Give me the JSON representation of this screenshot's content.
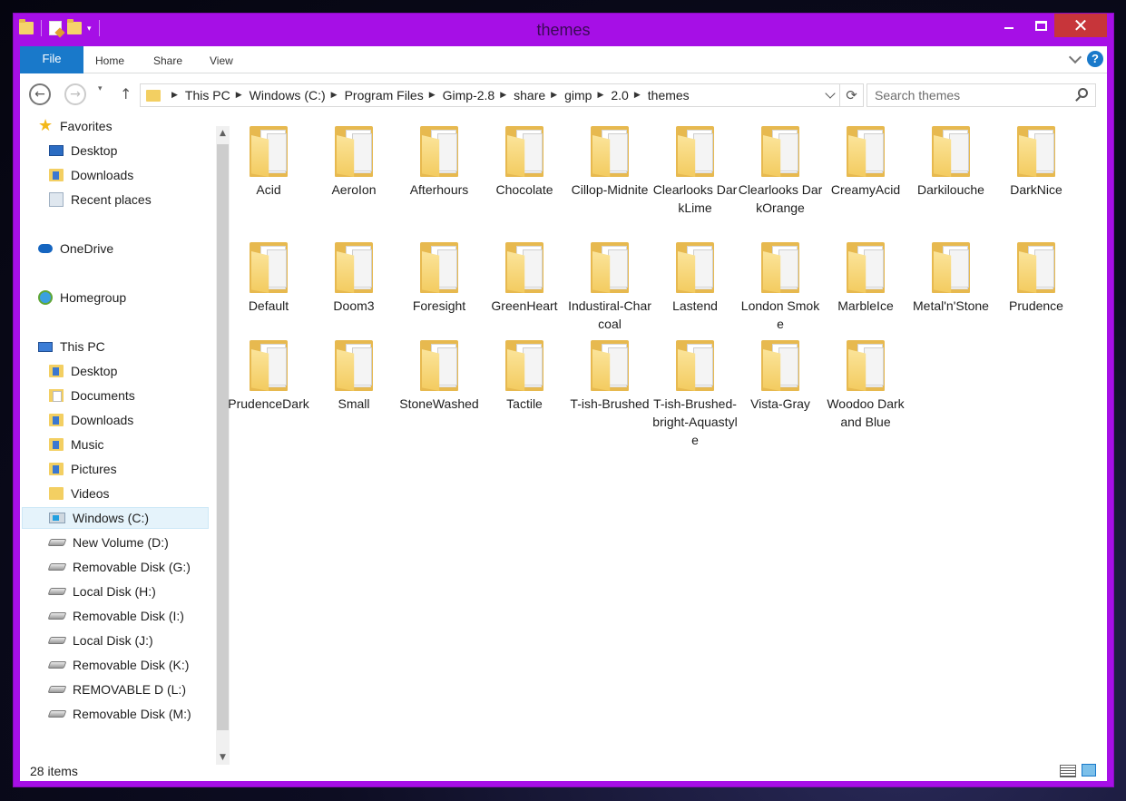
{
  "window": {
    "title": "themes"
  },
  "ribbon": {
    "tabs": [
      "File",
      "Home",
      "Share",
      "View"
    ]
  },
  "address": {
    "crumbs": [
      "This PC",
      "Windows (C:)",
      "Program Files",
      "Gimp-2.8",
      "share",
      "gimp",
      "2.0",
      "themes"
    ]
  },
  "search": {
    "placeholder": "Search themes"
  },
  "sidebar": {
    "items": [
      {
        "label": "Favorites",
        "icon": "star-icon"
      },
      {
        "label": "Desktop",
        "icon": "desktop-icon"
      },
      {
        "label": "Downloads",
        "icon": "downloads-folder-icon"
      },
      {
        "label": "Recent places",
        "icon": "recent-places-icon"
      },
      {
        "label": "OneDrive",
        "icon": "onedrive-icon"
      },
      {
        "label": "Homegroup",
        "icon": "homegroup-icon"
      },
      {
        "label": "This PC",
        "icon": "this-pc-icon"
      },
      {
        "label": "Desktop",
        "icon": "folder-icon"
      },
      {
        "label": "Documents",
        "icon": "documents-icon"
      },
      {
        "label": "Downloads",
        "icon": "downloads-folder-icon"
      },
      {
        "label": "Music",
        "icon": "music-folder-icon"
      },
      {
        "label": "Pictures",
        "icon": "pictures-folder-icon"
      },
      {
        "label": "Videos",
        "icon": "videos-folder-icon"
      },
      {
        "label": "Windows (C:)",
        "icon": "windows-drive-icon"
      },
      {
        "label": "New Volume (D:)",
        "icon": "drive-icon"
      },
      {
        "label": "Removable Disk (G:)",
        "icon": "drive-icon"
      },
      {
        "label": "Local Disk (H:)",
        "icon": "drive-icon"
      },
      {
        "label": "Removable Disk (I:)",
        "icon": "drive-icon"
      },
      {
        "label": "Local Disk (J:)",
        "icon": "drive-icon"
      },
      {
        "label": "Removable Disk (K:)",
        "icon": "drive-icon"
      },
      {
        "label": "REMOVABLE D (L:)",
        "icon": "drive-icon"
      },
      {
        "label": "Removable Disk (M:)",
        "icon": "drive-icon"
      }
    ],
    "selected": "Windows (C:)"
  },
  "folders": [
    {
      "name": "Acid"
    },
    {
      "name": "AeroIon"
    },
    {
      "name": "Afterhours"
    },
    {
      "name": "Chocolate"
    },
    {
      "name": "Cillop-Midnite"
    },
    {
      "name": "Clearlooks DarkLime"
    },
    {
      "name": "Clearlooks DarkOrange"
    },
    {
      "name": "CreamyAcid"
    },
    {
      "name": "Darkilouche"
    },
    {
      "name": "DarkNice"
    },
    {
      "name": "Default"
    },
    {
      "name": "Doom3"
    },
    {
      "name": "Foresight"
    },
    {
      "name": "GreenHeart"
    },
    {
      "name": "Industiral-Charcoal"
    },
    {
      "name": "Lastend"
    },
    {
      "name": "London Smoke"
    },
    {
      "name": "MarbleIce"
    },
    {
      "name": "Metal'n'Stone"
    },
    {
      "name": "Prudence"
    },
    {
      "name": "PrudenceDark"
    },
    {
      "name": "Small"
    },
    {
      "name": "StoneWashed"
    },
    {
      "name": "Tactile"
    },
    {
      "name": "T-ish-Brushed"
    },
    {
      "name": "T-ish-Brushed-bright-Aquastyle"
    },
    {
      "name": "Vista-Gray"
    },
    {
      "name": "Woodoo Dark and Blue"
    }
  ],
  "status": {
    "count": "28 items"
  },
  "colors": {
    "frame": "#a60fe6",
    "accent": "#1979ca",
    "close": "#c7353a",
    "folder": "#f3cb5f"
  }
}
